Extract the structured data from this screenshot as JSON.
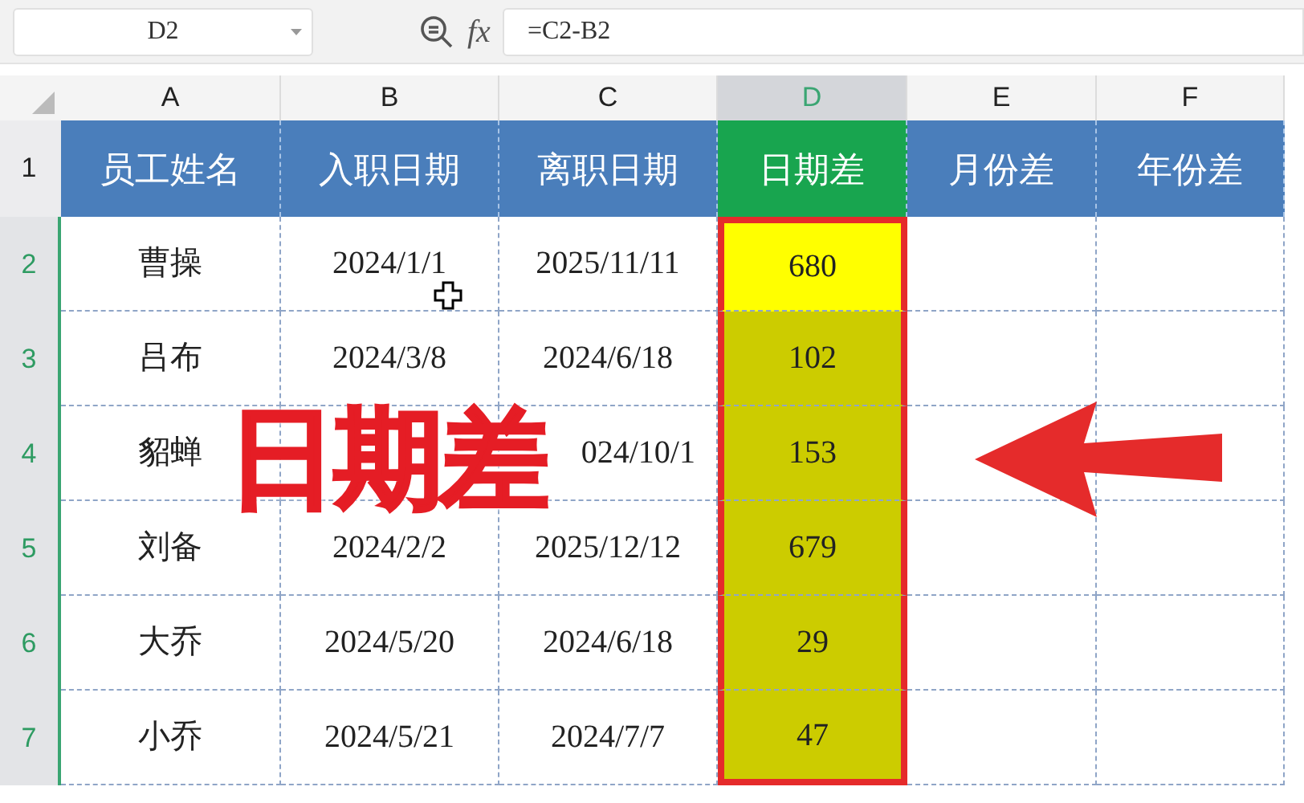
{
  "name_box": "D2",
  "function_label": "fx",
  "formula": "=C2-B2",
  "columns": [
    {
      "label": "A",
      "selected": false
    },
    {
      "label": "B",
      "selected": false
    },
    {
      "label": "C",
      "selected": false
    },
    {
      "label": "D",
      "selected": true
    },
    {
      "label": "E",
      "selected": false
    },
    {
      "label": "F",
      "selected": false
    }
  ],
  "header_row": {
    "number": "1",
    "cells": [
      {
        "text": "员工姓名",
        "highlighted": false
      },
      {
        "text": "入职日期",
        "highlighted": false
      },
      {
        "text": "离职日期",
        "highlighted": false
      },
      {
        "text": "日期差",
        "highlighted": true
      },
      {
        "text": "月份差",
        "highlighted": false
      },
      {
        "text": "年份差",
        "highlighted": false
      }
    ]
  },
  "rows": [
    {
      "number": "2",
      "selected": true,
      "name": "曹操",
      "hire_date": "2024/1/1",
      "leave_date": "2025/11/11",
      "days": "680",
      "days_active": true
    },
    {
      "number": "3",
      "selected": true,
      "name": "吕布",
      "hire_date": "2024/3/8",
      "leave_date": "2024/6/18",
      "days": "102",
      "days_active": false
    },
    {
      "number": "4",
      "selected": true,
      "name": "貂蝉",
      "leave_date": "024/10/1",
      "days": "153",
      "days_active": false
    },
    {
      "number": "5",
      "selected": true,
      "name": "刘备",
      "hire_date": "2024/2/2",
      "leave_date": "2025/12/12",
      "days": "679",
      "days_active": false
    },
    {
      "number": "6",
      "selected": true,
      "name": "大乔",
      "hire_date": "2024/5/20",
      "leave_date": "2024/6/18",
      "days": "29",
      "days_active": false
    },
    {
      "number": "7",
      "selected": true,
      "name": "小乔",
      "hire_date": "2024/5/21",
      "leave_date": "2024/7/7",
      "days": "47",
      "days_active": false
    }
  ],
  "overlay_caption": "日期差"
}
